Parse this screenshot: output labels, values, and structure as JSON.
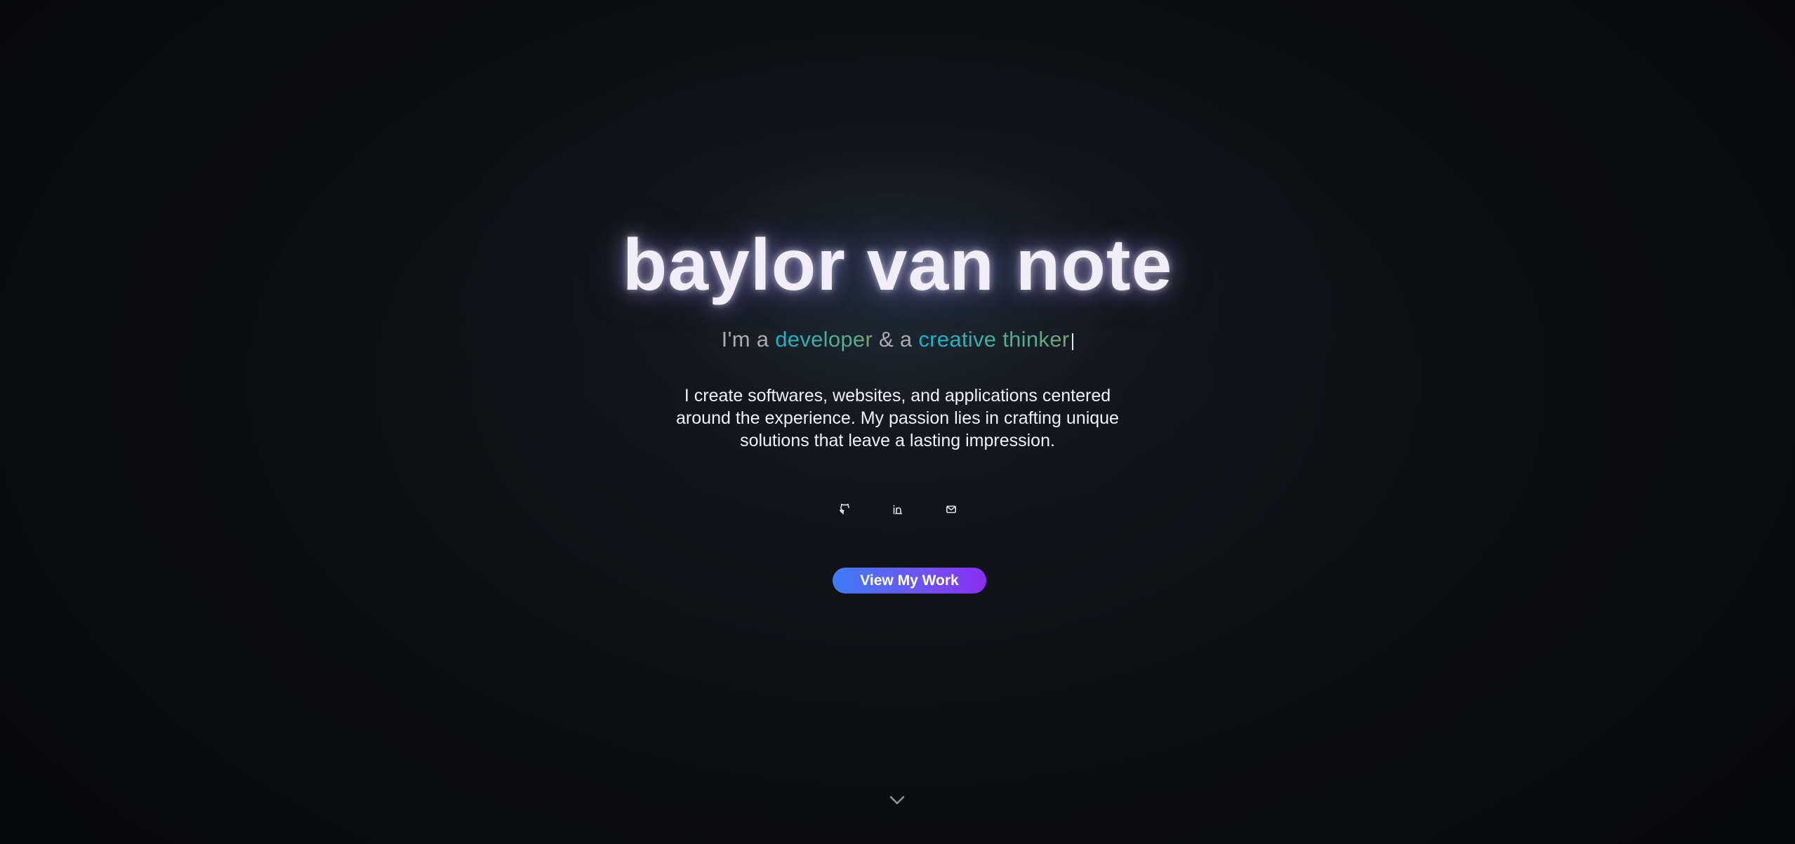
{
  "hero": {
    "name": "baylor van note",
    "tagline": {
      "prefix": "I'm a ",
      "role_one": "developer",
      "joiner": " & a ",
      "role_two": "creative thinker"
    },
    "bio": "I create softwares, websites, and applications centered around the experience. My passion lies in crafting unique solutions that leave a lasting impression."
  },
  "socials": [
    {
      "icon": "github-icon"
    },
    {
      "icon": "linkedin-icon"
    },
    {
      "icon": "mail-icon"
    }
  ],
  "cta": {
    "label": "View My Work"
  },
  "scroll_indicator": {
    "icon": "chevron-down-icon"
  },
  "colors": {
    "background": "#0b0c0f",
    "title": "#f1eefa",
    "accent_gradient_start": "#17b3c8",
    "accent_gradient_end": "#7aa36f",
    "button_gradient_start": "#3f7cf6",
    "button_gradient_end": "#8a2ff0"
  }
}
